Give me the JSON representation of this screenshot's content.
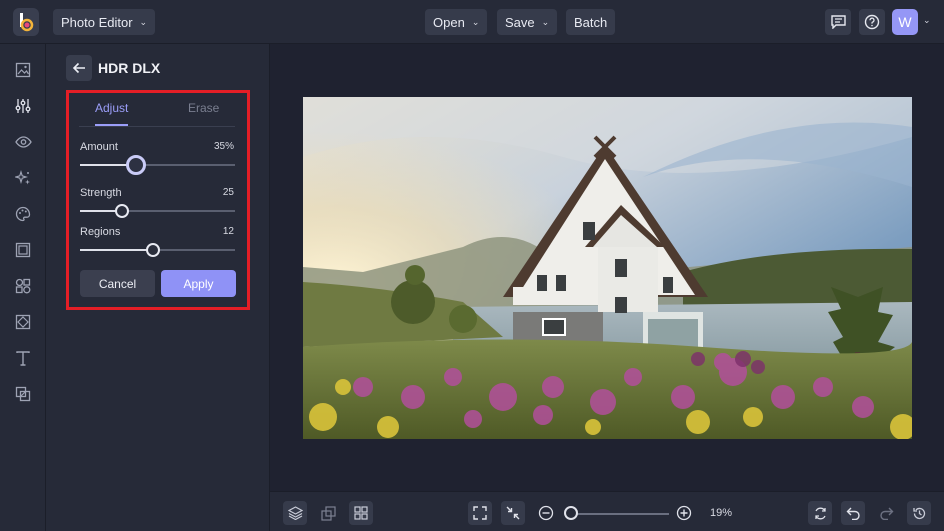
{
  "topbar": {
    "app_menu_label": "Photo Editor",
    "open_label": "Open",
    "save_label": "Save",
    "batch_label": "Batch",
    "avatar_initial": "W"
  },
  "rail": {
    "items": [
      "image-icon",
      "sliders-icon",
      "eye-icon",
      "sparkle-icon",
      "palette-icon",
      "frame-icon",
      "shapes-icon",
      "texture-icon",
      "text-icon",
      "overlay-icon"
    ]
  },
  "panel": {
    "title": "HDR DLX",
    "tabs": [
      {
        "label": "Adjust",
        "active": true
      },
      {
        "label": "Erase",
        "active": false
      }
    ],
    "sliders": [
      {
        "label": "Amount",
        "value": "35%",
        "fraction": 0.36
      },
      {
        "label": "Strength",
        "value": "25",
        "fraction": 0.27
      },
      {
        "label": "Regions",
        "value": "12",
        "fraction": 0.47
      }
    ],
    "cancel_label": "Cancel",
    "apply_label": "Apply"
  },
  "bottombar": {
    "zoom_label": "19%",
    "zoom_fraction": 0.0
  },
  "colors": {
    "accent": "#9b9ef9",
    "apply": "#8f92f6",
    "highlight": "#e41e26",
    "background": "#1f2230",
    "panel": "#262a38"
  }
}
